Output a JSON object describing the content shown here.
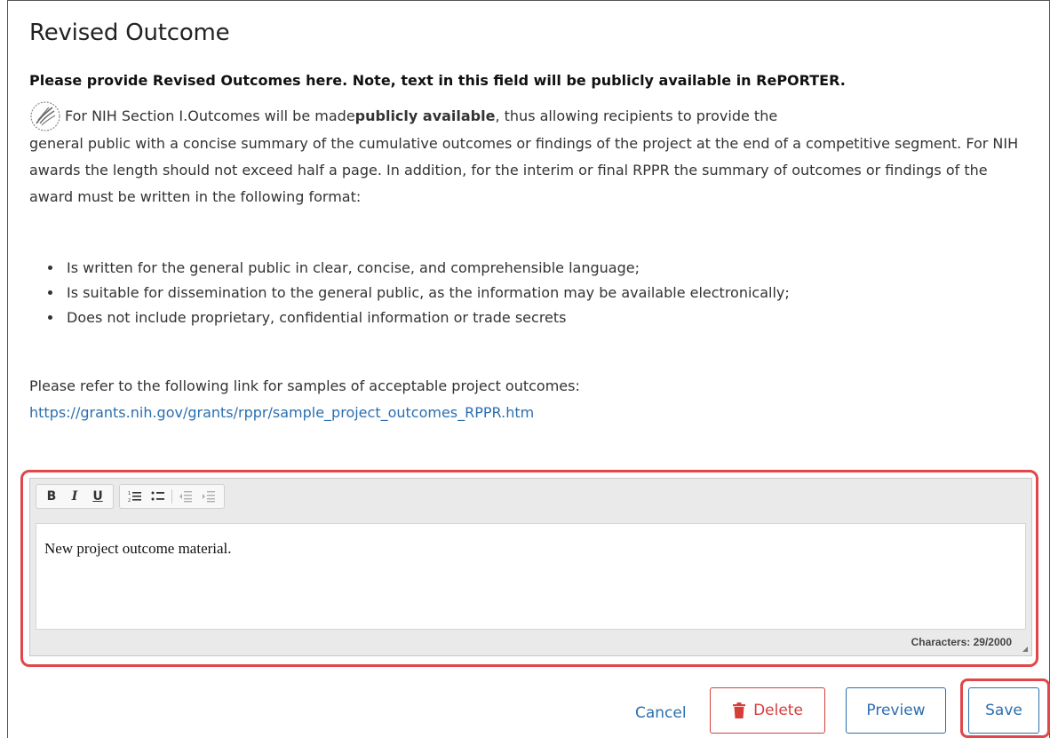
{
  "section": {
    "title": "Revised Outcome",
    "instruction": "Please provide Revised Outcomes here. Note, text in this field will be publicly available in RePORTER."
  },
  "guidance": {
    "intro_before_bold": "For NIH Section I.Outcomes will be made ",
    "intro_bold": "publicly available",
    "intro_after_bold": ", thus allowing recipients to provide the",
    "continuation": "general public with a concise summary of the cumulative outcomes or findings of the project at the end of a competitive segment. For NIH awards the length should not exceed half a page. In addition, for the interim or final RPPR the summary of outcomes or findings of the award must be written in the following format:",
    "bullets": [
      "Is written for the general public in clear, concise, and comprehensible language;",
      "Is suitable for dissemination to the general public, as the information may be available electronically;",
      "Does not include proprietary, confidential information or trade secrets"
    ],
    "refer_text": "Please refer to the following link for samples of acceptable project outcomes:",
    "refer_link": "https://grants.nih.gov/grants/rppr/sample_project_outcomes_RPPR.htm"
  },
  "editor": {
    "toolbar": {
      "bold": "B",
      "italic": "I",
      "underline": "U"
    },
    "content": "New project outcome material.",
    "char_count": "Characters: 29/2000"
  },
  "actions": {
    "cancel": "Cancel",
    "delete": "Delete",
    "preview": "Preview",
    "save": "Save"
  },
  "colors": {
    "link": "#2a6fb0",
    "danger": "#d43f3a",
    "highlight": "#e0464a"
  }
}
